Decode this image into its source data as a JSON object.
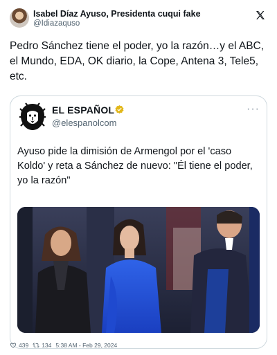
{
  "author": {
    "name": "Isabel Díaz Ayuso, Presidenta cuqui fake",
    "handle": "@Idiazaquso"
  },
  "tweet_text": "Pedro Sánchez tiene el poder, yo la razón…y el ABC, el Mundo, EDA, OK diario, la Cope, Antena 3, Tele5, etc.",
  "quoted": {
    "name": "EL ESPAÑOL",
    "handle": "@elespanolcom",
    "more_label": "···",
    "headline": "Ayuso pide la dimisión de Armengol por el 'caso Koldo' y reta a Sánchez de nuevo: \"Él tiene el poder, yo la razón\""
  },
  "footer": {
    "likes": "439",
    "retweets": "134",
    "timestamp": "5:38 AM - Feb 29, 2024"
  },
  "icons": {
    "brand": "x-logo-icon",
    "verified": "verified-badge-icon",
    "like": "heart-icon",
    "retweet": "retweet-icon"
  },
  "colors": {
    "verified_gold": "#e2b719",
    "secondary_text": "#536471",
    "border": "#cfd9de"
  }
}
